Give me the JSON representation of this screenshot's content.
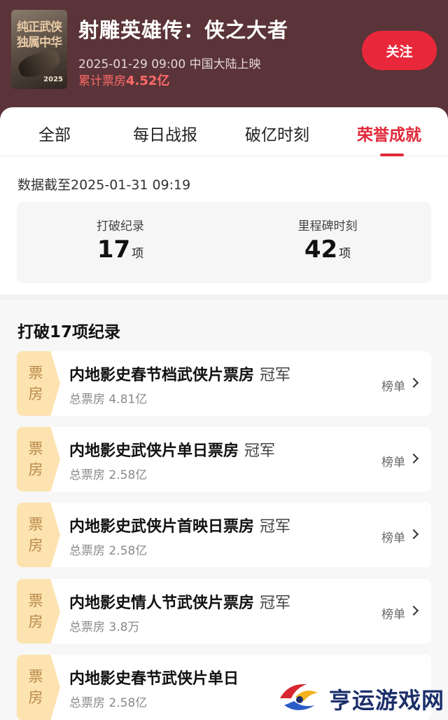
{
  "header": {
    "poster_text": "纯正武侠独属中华",
    "poster_year": "2025",
    "title": "射雕英雄传：侠之大者",
    "release": "2025-01-29 09:00 中国大陆上映",
    "boxoffice_prefix": "累计票房",
    "boxoffice_amount": "4.52亿",
    "follow_label": "关注"
  },
  "tabs": [
    {
      "label": "全部"
    },
    {
      "label": "每日战报"
    },
    {
      "label": "破亿时刻"
    },
    {
      "label": "荣誉成就",
      "active": true
    }
  ],
  "data_date": "数据截至2025-01-31  09:19",
  "stats": [
    {
      "label": "打破纪录",
      "value": "17",
      "unit": "项"
    },
    {
      "label": "里程碑时刻",
      "value": "42",
      "unit": "项"
    }
  ],
  "records_section": {
    "title": "打破17项纪录",
    "items": [
      {
        "tag_line1": "票",
        "tag_line2": "房",
        "title": "内地影史春节档武侠片票房",
        "champion": "冠军",
        "sub": "总票房 4.81亿",
        "link": "榜单"
      },
      {
        "tag_line1": "票",
        "tag_line2": "房",
        "title": "内地影史武侠片单日票房",
        "champion": "冠军",
        "sub": "总票房 2.58亿",
        "link": "榜单"
      },
      {
        "tag_line1": "票",
        "tag_line2": "房",
        "title": "内地影史武侠片首映日票房",
        "champion": "冠军",
        "sub": "总票房 2.58亿",
        "link": "榜单"
      },
      {
        "tag_line1": "票",
        "tag_line2": "房",
        "title": "内地影史情人节武侠片票房",
        "champion": "冠军",
        "sub": "总票房 3.8万",
        "link": "榜单"
      },
      {
        "tag_line1": "票",
        "tag_line2": "房",
        "title": "内地影史春节武侠片单日",
        "champion": "",
        "sub": "总票房 2.58亿",
        "link": ""
      }
    ]
  },
  "watermark": {
    "text": "亨运游戏网"
  },
  "colors": {
    "header_bg": "#5a3438",
    "accent": "#e02a3a",
    "follow_button": "#e8283a",
    "tag_bg": "#fde3b0",
    "tag_text": "#b98a4c",
    "boxoffice": "#ff6a6a"
  }
}
